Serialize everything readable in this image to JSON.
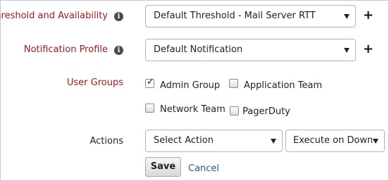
{
  "threshold": {
    "label": "Threshold and Availability",
    "info_icon": "info-icon",
    "selected": "Default Threshold - Mail Server RTT",
    "add_icon": "plus-icon"
  },
  "notification": {
    "label": "Notification Profile",
    "info_icon": "info-icon",
    "selected": "Default Notification",
    "add_icon": "plus-icon"
  },
  "user_groups": {
    "label": "User Groups",
    "options": [
      {
        "label": "Admin Group",
        "checked": true
      },
      {
        "label": "Application Team",
        "checked": false
      },
      {
        "label": "Network Team",
        "checked": false
      },
      {
        "label": "PagerDuty",
        "checked": false
      }
    ]
  },
  "actions": {
    "label": "Actions",
    "action_selected": "Select Action",
    "trigger_selected": "Execute on Down"
  },
  "buttons": {
    "save": "Save",
    "cancel": "Cancel"
  },
  "colors": {
    "label_red": "#9a1a1a",
    "link_blue": "#1a5a96"
  }
}
